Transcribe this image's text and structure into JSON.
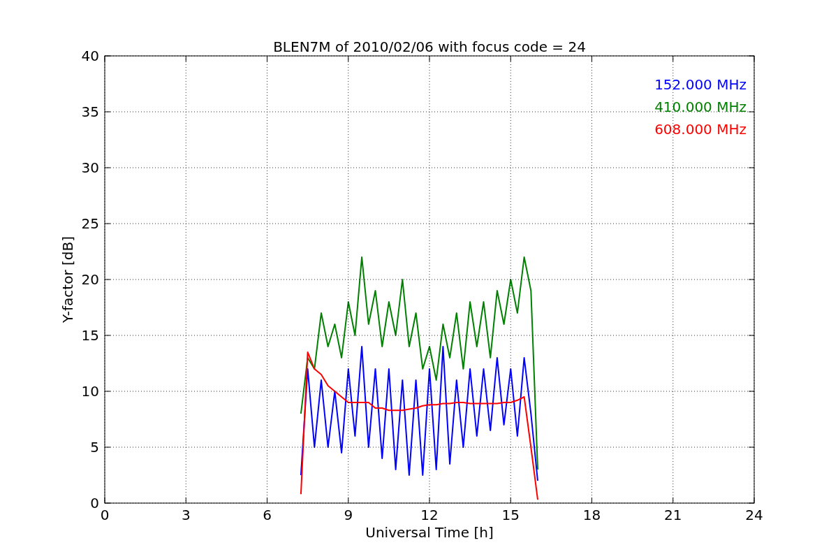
{
  "figure": {
    "chart_data": {
      "type": "line",
      "title": "BLEN7M of 2010/02/06 with focus code = 24",
      "xlabel": "Universal Time [h]",
      "ylabel": "Y-factor [dB]",
      "x": [
        7.25,
        7.5,
        7.75,
        8,
        8.25,
        8.5,
        8.75,
        9,
        9.25,
        9.5,
        9.75,
        10,
        10.25,
        10.5,
        10.75,
        11,
        11.25,
        11.5,
        11.75,
        12,
        12.25,
        12.5,
        12.75,
        13,
        13.25,
        13.5,
        13.75,
        14,
        14.25,
        14.5,
        14.75,
        15,
        15.25,
        15.5,
        15.75,
        16
      ],
      "series": [
        {
          "name": "152.000 MHz",
          "color": "#0000ff",
          "values": [
            2.5,
            12,
            5,
            11,
            5,
            10,
            4.5,
            12,
            6,
            14,
            5,
            12,
            4,
            12,
            3,
            11,
            2.5,
            11,
            2.5,
            12,
            3,
            14,
            3.5,
            11,
            5,
            12,
            6,
            12,
            6.5,
            13,
            7,
            12,
            6,
            13,
            8,
            2
          ]
        },
        {
          "name": "410.000 MHz",
          "color": "#008000",
          "values": [
            8,
            13,
            12,
            17,
            14,
            16,
            13,
            18,
            15,
            22,
            16,
            19,
            14,
            18,
            15,
            20,
            14,
            17,
            12,
            14,
            11,
            16,
            13,
            17,
            12,
            18,
            14,
            18,
            13,
            19,
            16,
            20,
            17,
            22,
            19,
            3
          ]
        },
        {
          "name": "608.000 MHz",
          "color": "#ff0000",
          "values": [
            0.8,
            13.5,
            12,
            11.5,
            10.5,
            10,
            9.5,
            9,
            9,
            9,
            9,
            8.5,
            8.5,
            8.3,
            8.3,
            8.3,
            8.4,
            8.5,
            8.7,
            8.8,
            8.8,
            8.9,
            8.9,
            9,
            9,
            8.9,
            8.9,
            8.9,
            8.9,
            8.9,
            9,
            9,
            9.2,
            9.5,
            5,
            0.3
          ]
        }
      ],
      "xlim": [
        0,
        24
      ],
      "ylim": [
        0,
        40
      ],
      "xticks": [
        0,
        3,
        6,
        9,
        12,
        15,
        18,
        21,
        24
      ],
      "yticks": [
        0,
        5,
        10,
        15,
        20,
        25,
        30,
        35,
        40
      ],
      "grid": true
    }
  }
}
